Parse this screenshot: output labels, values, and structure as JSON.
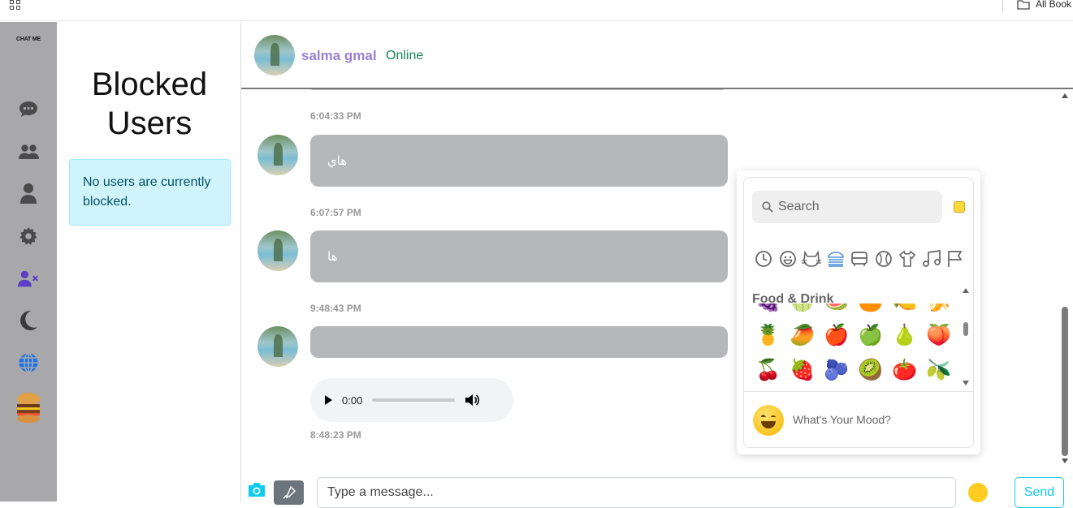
{
  "browser": {
    "bookmarks_label": "All Book",
    "apps_icon": "apps-grid-icon",
    "folder_icon": "folder-icon"
  },
  "sidebar": {
    "logo_text": "CHAT ME",
    "icons": [
      "chat-icon",
      "users-icon",
      "user-icon",
      "gear-icon",
      "user-block-icon",
      "moon-icon",
      "globe-icon",
      "burger-avatar"
    ]
  },
  "blocked": {
    "title_line1": "Blocked",
    "title_line2": "Users",
    "empty_message": "No users are currently blocked."
  },
  "chat": {
    "contact_name": "salma gmal",
    "status": "Online",
    "messages": [
      {
        "time": "6:04:33 PM"
      },
      {
        "text": "هاي",
        "time": "6:07:57 PM"
      },
      {
        "text": "ها",
        "time": "9:48:43 PM"
      },
      {
        "text": "",
        "time": ""
      },
      {
        "type": "audio",
        "current": "0:00",
        "time": "8:48:23 PM"
      }
    ]
  },
  "emoji_picker": {
    "search_placeholder": "Search",
    "category_label": "Food & Drink",
    "categories": [
      "recent-icon",
      "smileys-icon",
      "animals-icon",
      "food-icon",
      "travel-icon",
      "activities-icon",
      "objects-icon",
      "symbols-icon",
      "flags-icon"
    ],
    "active_category": "food-icon",
    "rows": [
      [
        "🍇",
        "🍈",
        "🍉",
        "🍊",
        "🍋",
        "🍌"
      ],
      [
        "🍍",
        "🥭",
        "🍎",
        "🍏",
        "🍐",
        "🍑"
      ],
      [
        "🍒",
        "🍓",
        "🫐",
        "🥝",
        "🍅",
        "🫒"
      ]
    ],
    "mood_prompt": "What's Your Mood?"
  },
  "composer": {
    "placeholder": "Type a message...",
    "send_label": "Send"
  },
  "colors": {
    "accent_purple": "#9b7fd1",
    "online_green": "#198754",
    "bubble_gray": "#b6b7bb",
    "send_cyan": "#0dcaf0",
    "alert_bg": "#cff4fc"
  }
}
